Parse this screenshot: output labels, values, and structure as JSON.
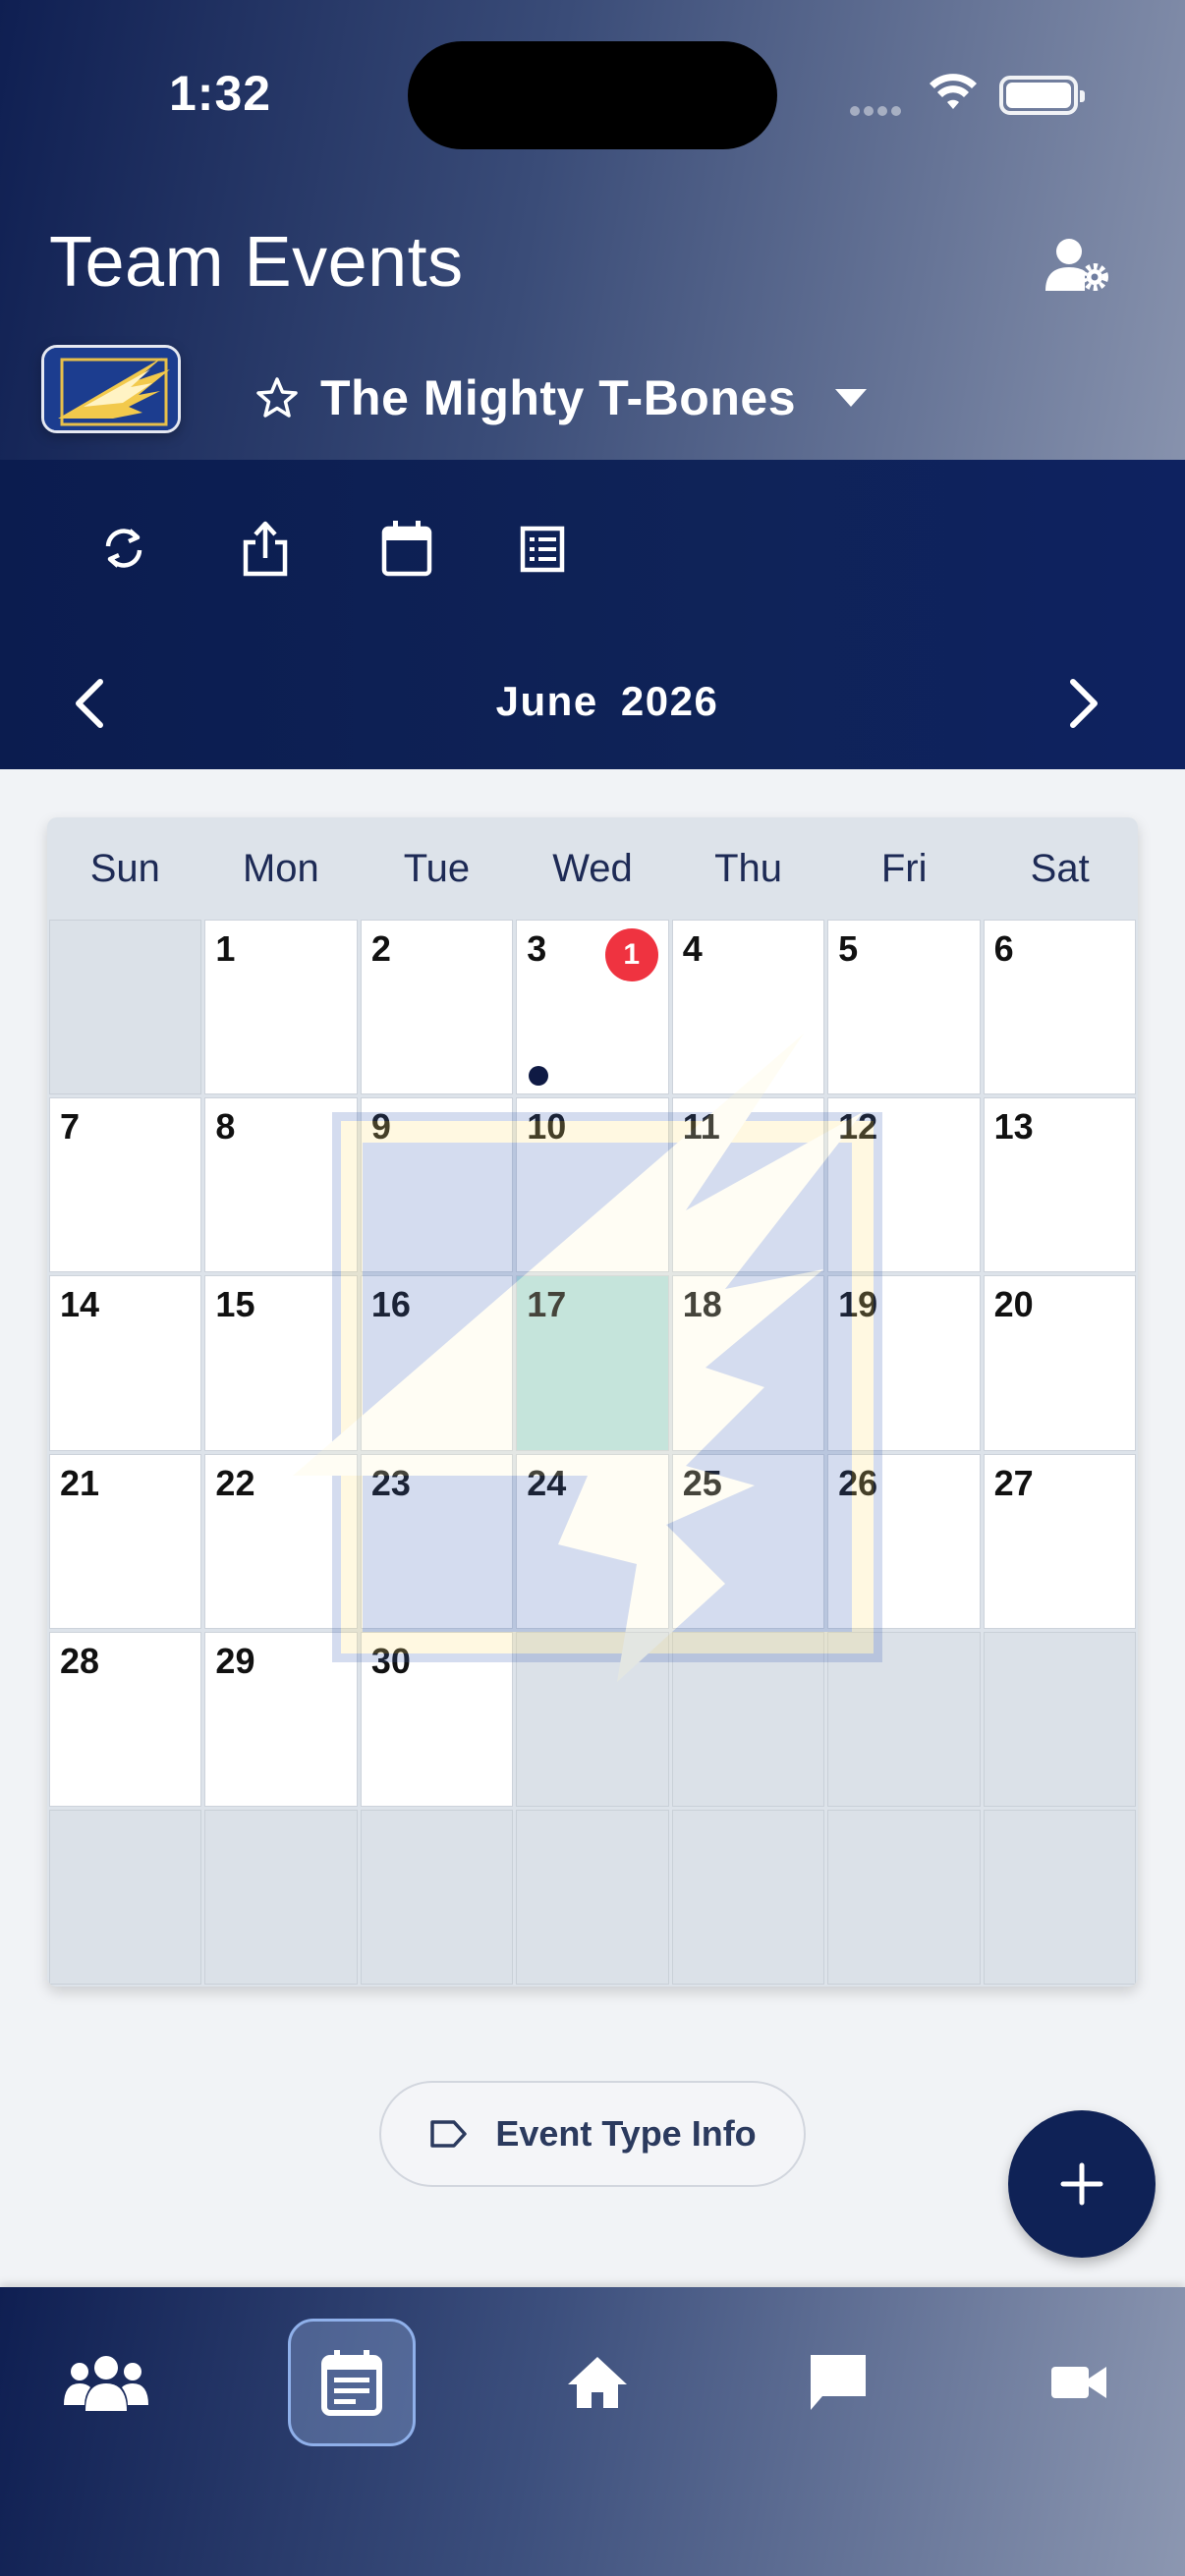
{
  "status_bar": {
    "time": "1:32"
  },
  "header": {
    "title": "Team Events",
    "team_name": "The Mighty T-Bones"
  },
  "toolbar": {
    "icons": [
      "refresh-icon",
      "share-icon",
      "calendar-icon",
      "list-icon"
    ]
  },
  "calendar": {
    "month_label": "June  2026",
    "weekdays": [
      "Sun",
      "Mon",
      "Tue",
      "Wed",
      "Thu",
      "Fri",
      "Sat"
    ],
    "days": [
      {
        "n": ""
      },
      {
        "n": "1"
      },
      {
        "n": "2"
      },
      {
        "n": "3",
        "badge": "1",
        "dot": true
      },
      {
        "n": "4"
      },
      {
        "n": "5"
      },
      {
        "n": "6"
      },
      {
        "n": "7"
      },
      {
        "n": "8"
      },
      {
        "n": "9"
      },
      {
        "n": "10"
      },
      {
        "n": "11"
      },
      {
        "n": "12"
      },
      {
        "n": "13"
      },
      {
        "n": "14"
      },
      {
        "n": "15"
      },
      {
        "n": "16"
      },
      {
        "n": "17",
        "today": true
      },
      {
        "n": "18"
      },
      {
        "n": "19"
      },
      {
        "n": "20"
      },
      {
        "n": "21"
      },
      {
        "n": "22"
      },
      {
        "n": "23"
      },
      {
        "n": "24"
      },
      {
        "n": "25"
      },
      {
        "n": "26"
      },
      {
        "n": "27"
      },
      {
        "n": "28"
      },
      {
        "n": "29"
      },
      {
        "n": "30"
      },
      {
        "n": ""
      },
      {
        "n": ""
      },
      {
        "n": ""
      },
      {
        "n": ""
      },
      {
        "n": ""
      },
      {
        "n": ""
      },
      {
        "n": ""
      },
      {
        "n": ""
      },
      {
        "n": ""
      },
      {
        "n": ""
      },
      {
        "n": ""
      }
    ],
    "colors": {
      "badge": "#ef3340",
      "today": "#b5dfdf",
      "empty": "#dbe1e8"
    }
  },
  "actions": {
    "event_type_label": "Event Type Info",
    "fab_icon": "plus-icon"
  },
  "tab_bar": {
    "items": [
      {
        "icon": "team-icon"
      },
      {
        "icon": "events-icon",
        "active": true
      },
      {
        "icon": "home-icon"
      },
      {
        "icon": "chat-icon"
      },
      {
        "icon": "video-icon"
      }
    ]
  },
  "colors": {
    "navy": "#0f2256",
    "accent": "#8fb0ea"
  }
}
